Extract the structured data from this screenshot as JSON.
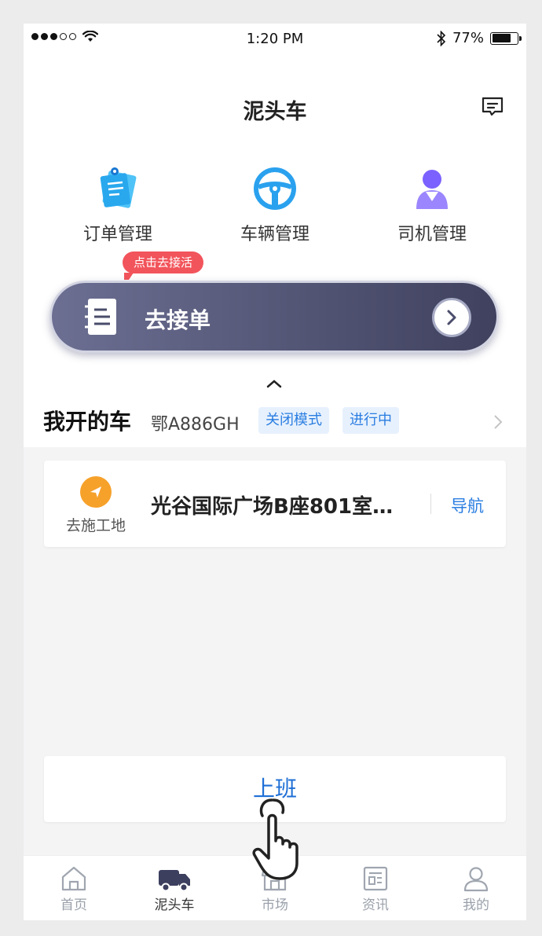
{
  "status_bar": {
    "time": "1:20 PM",
    "battery": "77%",
    "battery_level": 0.77
  },
  "header": {
    "title": "泥头车",
    "message_icon": "message-icon"
  },
  "shortcuts": [
    {
      "label": "订单管理",
      "icon": "order-icon"
    },
    {
      "label": "车辆管理",
      "icon": "steering-wheel-icon"
    },
    {
      "label": "司机管理",
      "icon": "driver-icon"
    }
  ],
  "promo": {
    "bubble": "点击去接活",
    "cta_label": "去接单"
  },
  "my_car": {
    "title": "我开的车",
    "plate": "鄂A886GH",
    "mode_tag": "关闭模式",
    "status_tag": "进行中"
  },
  "destination": {
    "label": "去施工地",
    "address": "光谷国际广场B座801室…",
    "nav_label": "导航"
  },
  "duty_button": "上班",
  "tabbar": [
    {
      "label": "首页",
      "icon": "home-icon",
      "active": false
    },
    {
      "label": "泥头车",
      "icon": "truck-icon",
      "active": true
    },
    {
      "label": "市场",
      "icon": "market-icon",
      "active": false
    },
    {
      "label": "资讯",
      "icon": "news-icon",
      "active": false
    },
    {
      "label": "我的",
      "icon": "profile-icon",
      "active": false
    }
  ],
  "colors": {
    "accent_blue": "#2a7de1",
    "cta_start": "#6c6f92",
    "cta_end": "#3f415e",
    "bubble_red": "#f2545b",
    "dest_orange": "#f6a12a"
  }
}
